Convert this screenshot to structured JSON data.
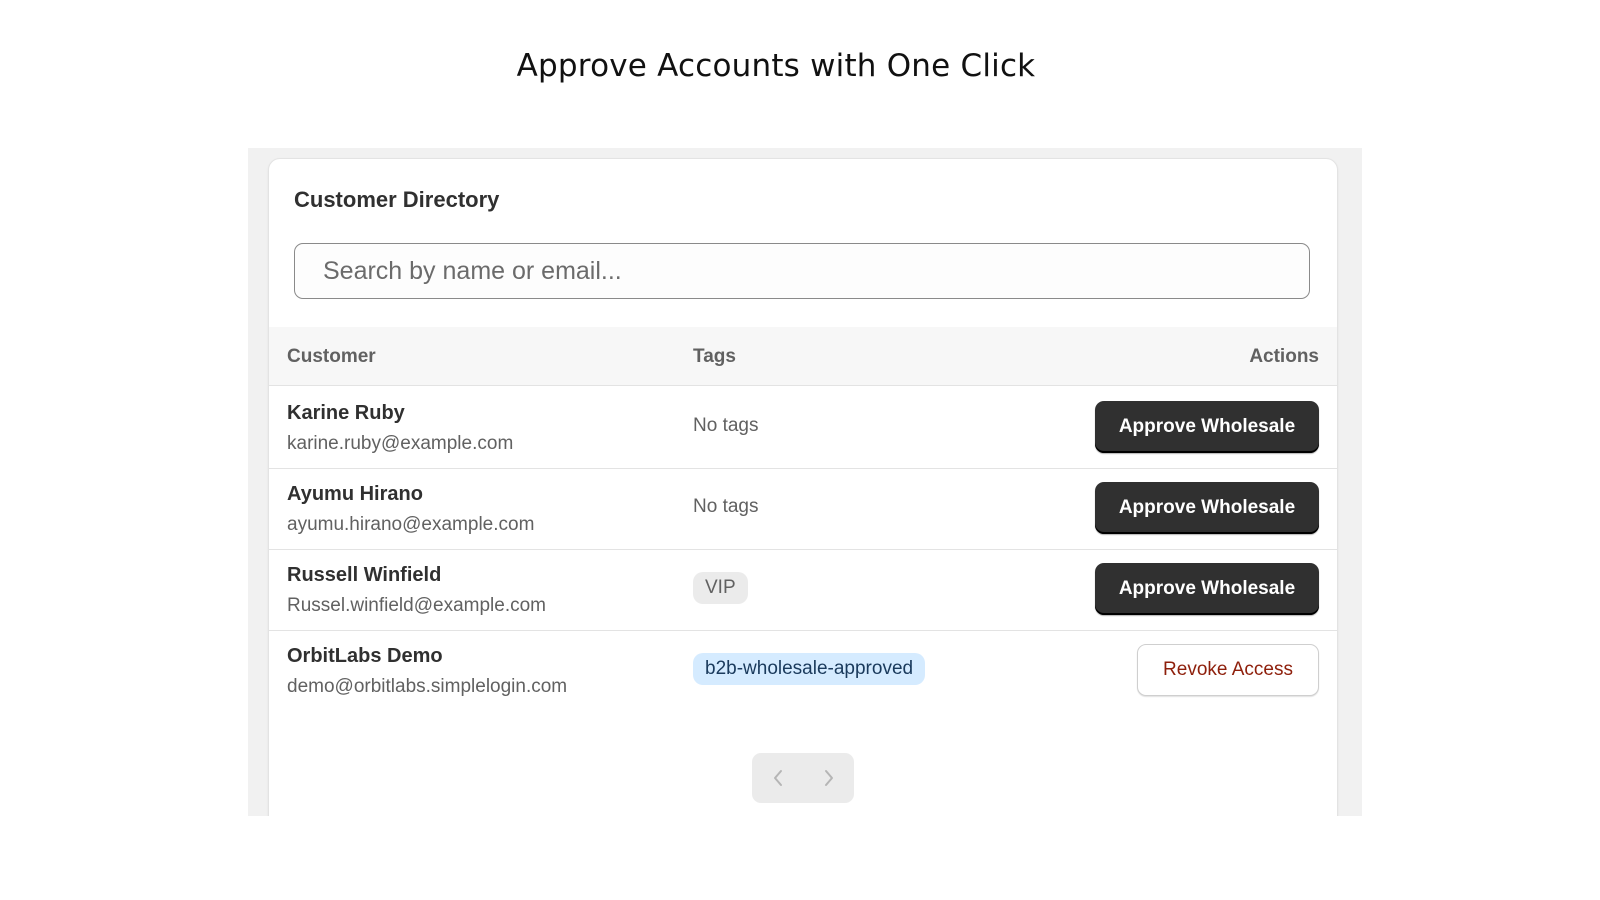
{
  "headline": "Approve Accounts with One Click",
  "card": {
    "title": "Customer Directory",
    "search": {
      "placeholder": "Search by name or email...",
      "value": ""
    }
  },
  "table": {
    "headers": {
      "customer": "Customer",
      "tags": "Tags",
      "actions": "Actions"
    },
    "rows": [
      {
        "name": "Karine Ruby",
        "email": "karine.ruby@example.com",
        "tag": "No tags",
        "action": "Approve Wholesale"
      },
      {
        "name": "Ayumu Hirano",
        "email": "ayumu.hirano@example.com",
        "tag": "No tags",
        "action": "Approve Wholesale"
      },
      {
        "name": "Russell Winfield",
        "email": "Russel.winfield@example.com",
        "tag": "VIP",
        "action": "Approve Wholesale"
      },
      {
        "name": "OrbitLabs Demo",
        "email": "demo@orbitlabs.simplelogin.com",
        "tag": "b2b-wholesale-approved",
        "action": "Revoke Access"
      }
    ]
  },
  "pagination": {
    "prev_icon": "chevron-left-icon",
    "next_icon": "chevron-right-icon",
    "prev_disabled": true,
    "next_disabled": true
  },
  "colors": {
    "primary_button": "#303030",
    "revoke_text": "#8e1f0b",
    "info_tag_bg": "#d5ebff",
    "neutral_tag_bg": "#ebebeb"
  }
}
